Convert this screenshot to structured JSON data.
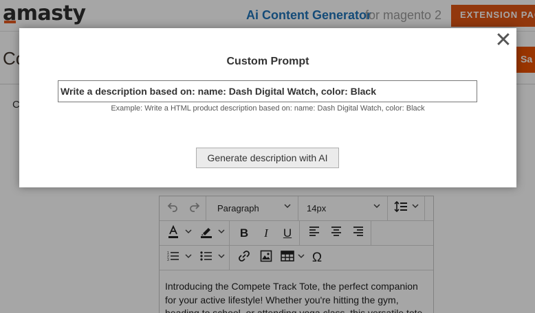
{
  "header": {
    "logo": "amasty",
    "product_title": "Ai Content Generator",
    "product_subtitle": "for magento 2",
    "extension_button": "EXTENSION PAGE"
  },
  "page": {
    "heading": "Co",
    "save_label": "Sa",
    "section_letter": "C"
  },
  "editor": {
    "block_format": "Paragraph",
    "font_size": "14px",
    "content": "Introducing the Compete Track Tote, the perfect companion for your active lifestyle! Whether you're hitting the gym, heading to school, or attending yoga class, this versatile tote"
  },
  "modal": {
    "title": "Custom Prompt",
    "prompt_value": "Write a description based on: name: Dash Digital Watch, color: Black",
    "hint": "Example: Write a HTML product description based on: name: Dash Digital Watch, color: Black",
    "generate_label": "Generate description with AI",
    "close_glyph": "✕"
  },
  "colors": {
    "brand_orange": "#e05614",
    "title_blue": "#1f74b9",
    "overlay": "rgba(0,0,0,0.35)"
  }
}
